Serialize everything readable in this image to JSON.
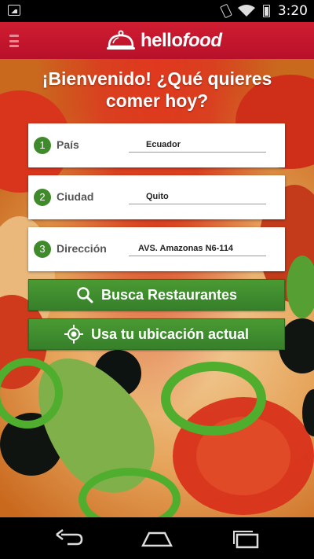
{
  "status_bar": {
    "time": "3:20",
    "icons": [
      "image-icon",
      "phone-icon",
      "wifi-icon",
      "battery-icon"
    ]
  },
  "app_bar": {
    "brand_prefix": "hello",
    "brand_suffix": "food",
    "icons": [
      "menu-icon",
      "cloche-icon"
    ]
  },
  "headline": "¡Bienvenido! ¿Qué quieres comer hoy?",
  "form": {
    "fields": [
      {
        "step": "1",
        "label": "País",
        "value": "Ecuador"
      },
      {
        "step": "2",
        "label": "Ciudad",
        "value": "Quito"
      },
      {
        "step": "3",
        "label": "Dirección",
        "value": "AVS. Amazonas N6-114"
      }
    ]
  },
  "buttons": {
    "search_label": "Busca Restaurantes",
    "location_label": "Usa tu ubicación actual"
  },
  "colors": {
    "brand_red": "#c8102e",
    "action_green": "#3f8a2a"
  },
  "nav_bar": {
    "icons": [
      "back-icon",
      "home-icon",
      "recent-apps-icon"
    ]
  }
}
